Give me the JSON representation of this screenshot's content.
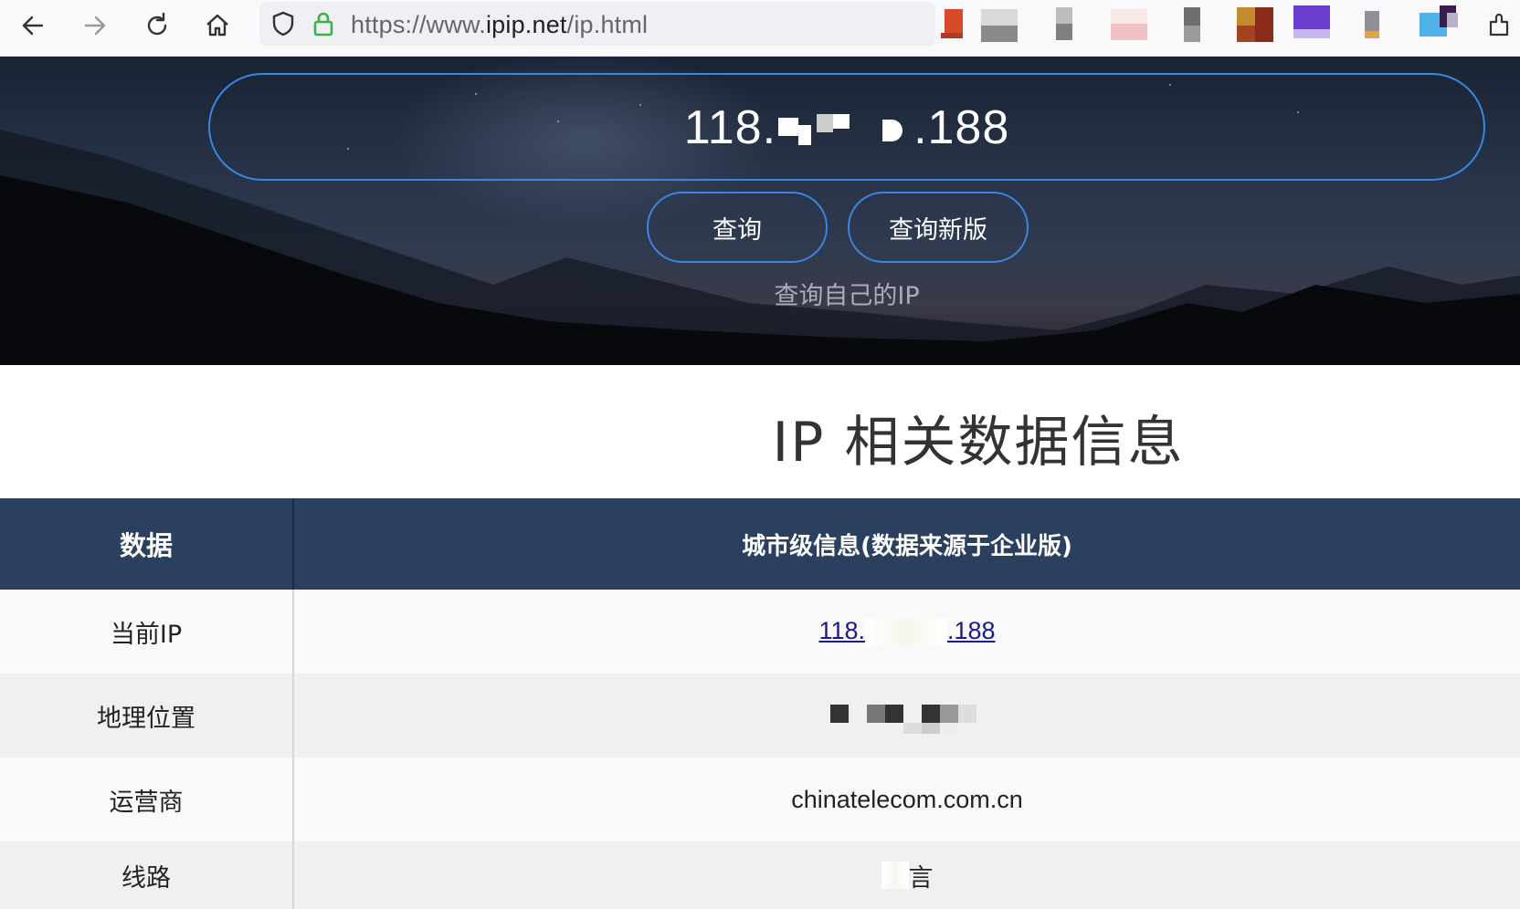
{
  "browser": {
    "url_scheme": "https://www.",
    "url_host": "ipip.net",
    "url_path": "/ip.html",
    "icons": [
      "back-icon",
      "forward-icon",
      "reload-icon",
      "home-icon",
      "shield-icon",
      "lock-icon",
      "extensions-icon"
    ]
  },
  "hero": {
    "ip_prefix": "118.",
    "ip_suffix": ".188",
    "query_button": "查询",
    "query_new_button": "查询新版",
    "self_ip_link": "查询自己的IP"
  },
  "section_title": "IP 相关数据信息",
  "table": {
    "headers": [
      "数据",
      "城市级信息(数据来源于企业版)"
    ],
    "rows": [
      {
        "label": "当前IP",
        "ip_prefix": "118.",
        "ip_suffix": ".188"
      },
      {
        "label": "地理位置",
        "value": ""
      },
      {
        "label": "运营商",
        "value": "chinatelecom.com.cn"
      },
      {
        "label": "线路",
        "value": "言"
      }
    ]
  },
  "colors": {
    "accent_border": "#3a86e0",
    "table_header": "#2b3f5e",
    "link": "#1a1a8c"
  }
}
